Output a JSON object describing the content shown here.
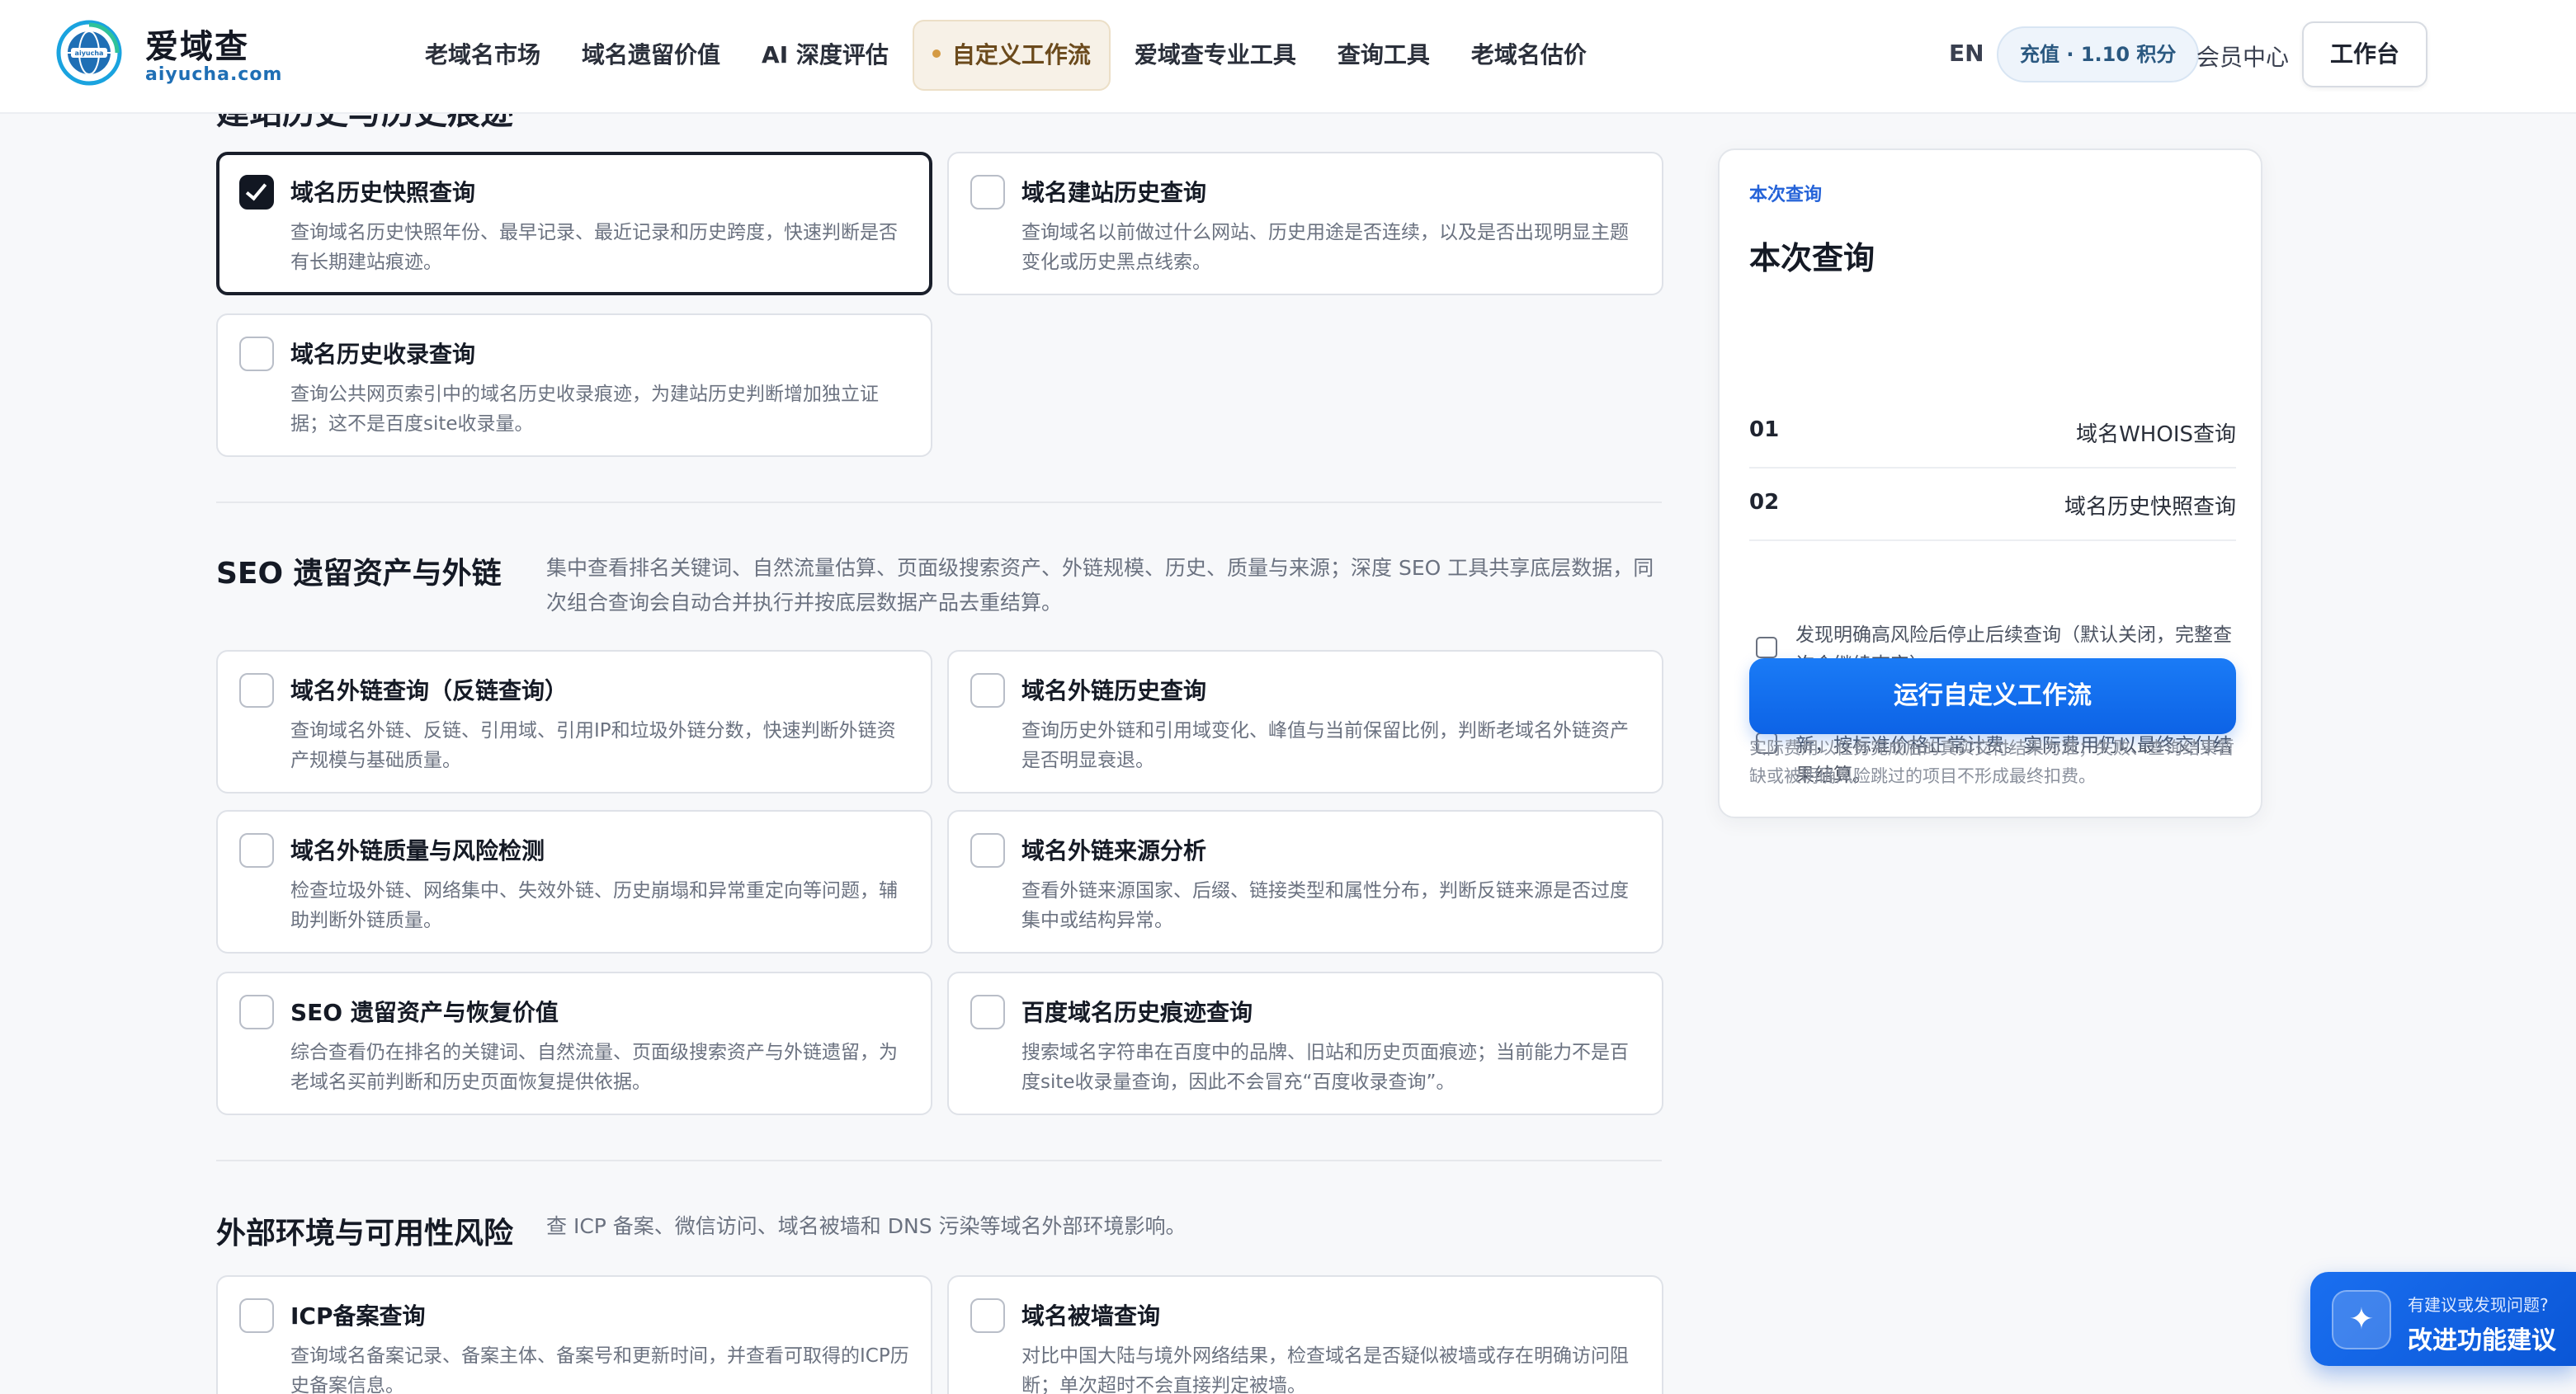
{
  "brand": {
    "name": "爱域查",
    "domain": "aiyucha.com",
    "logo_text": "aiyucha"
  },
  "nav": {
    "items": [
      {
        "label": "老域名市场"
      },
      {
        "label": "域名遗留价值"
      },
      {
        "label": "AI 深度评估"
      },
      {
        "label": "自定义工作流",
        "active": true
      },
      {
        "label": "爱域查专业工具"
      },
      {
        "label": "查询工具"
      },
      {
        "label": "老域名估价"
      }
    ]
  },
  "header_right": {
    "lang": "EN",
    "recharge": "充值 · 1.10 积分",
    "member": "会员中心",
    "workbench": "工作台"
  },
  "sections": [
    {
      "title": "建站历史与历史痕迹",
      "cards": [
        {
          "title": "域名历史快照查询",
          "desc": "查询域名历史快照年份、最早记录、最近记录和历史跨度，快速判断是否有长期建站痕迹。",
          "checked": true
        },
        {
          "title": "域名建站历史查询",
          "desc": "查询域名以前做过什么网站、历史用途是否连续，以及是否出现明显主题变化或历史黑点线索。",
          "checked": false
        },
        {
          "title": "域名历史收录查询",
          "desc": "查询公共网页索引中的域名历史收录痕迹，为建站历史判断增加独立证据；这不是百度site收录量。",
          "checked": false
        }
      ]
    },
    {
      "title": "SEO 遗留资产与外链",
      "desc": "集中查看排名关键词、自然流量估算、页面级搜索资产、外链规模、历史、质量与来源；深度 SEO 工具共享底层数据，同次组合查询会自动合并执行并按底层数据产品去重结算。",
      "cards": [
        {
          "title": "域名外链查询（反链查询）",
          "desc": "查询域名外链、反链、引用域、引用IP和垃圾外链分数，快速判断外链资产规模与基础质量。",
          "checked": false
        },
        {
          "title": "域名外链历史查询",
          "desc": "查询历史外链和引用域变化、峰值与当前保留比例，判断老域名外链资产是否明显衰退。",
          "checked": false
        },
        {
          "title": "域名外链质量与风险检测",
          "desc": "检查垃圾外链、网络集中、失效外链、历史崩塌和异常重定向等问题，辅助判断外链质量。",
          "checked": false
        },
        {
          "title": "域名外链来源分析",
          "desc": "查看外链来源国家、后缀、链接类型和属性分布，判断反链来源是否过度集中或结构异常。",
          "checked": false
        },
        {
          "title": "SEO 遗留资产与恢复价值",
          "desc": "综合查看仍在排名的关键词、自然流量、页面级搜索资产与外链遗留，为老域名买前判断和历史页面恢复提供依据。",
          "checked": false
        },
        {
          "title": "百度域名历史痕迹查询",
          "desc": "搜索域名字符串在百度中的品牌、旧站和历史页面痕迹；当前能力不是百度site收录量查询，因此不会冒充“百度收录查询”。",
          "checked": false
        }
      ]
    },
    {
      "title": "外部环境与可用性风险",
      "desc": "查 ICP 备案、微信访问、域名被墙和 DNS 污染等域名外部环境影响。",
      "cards": [
        {
          "title": "ICP备案查询",
          "desc": "查询域名备案记录、备案主体、备案号和更新时间，并查看可取得的ICP历史备案信息。",
          "checked": false
        },
        {
          "title": "域名被墙查询",
          "desc": "对比中国大陆与境外网络结果，检查域名是否疑似被墙或存在明确访问阻断；单次超时不会直接判定被墙。",
          "checked": false
        }
      ]
    }
  ],
  "panel": {
    "eyebrow": "本次查询",
    "title": "本次查询",
    "rows": [
      {
        "idx": "01",
        "name": "域名WHOIS查询"
      },
      {
        "idx": "02",
        "name": "域名历史快照查询"
      }
    ],
    "options": [
      {
        "text": "发现明确高风险后停止后续查询（默认关闭，完整查询会继续查完）",
        "checked": false
      },
      {
        "text": "默认优先使用有效缓存；勾选后忽略缓存并强制刷新，按标准价格正常计费。实际费用仍以最终交付结果结算。",
        "checked": false
      }
    ],
    "run_label": "运行自定义工作流",
    "fine_print": "实际费用以任务完成后的真实交付结果为准；失败、查询结果暂缺或被明确风险跳过的项目不形成最终扣费。"
  },
  "feedback": {
    "small": "有建议或发现问题?",
    "big": "改进功能建议"
  },
  "colors": {
    "accent": "#0d63e6",
    "nav_active_bg": "#f7f1e7",
    "selected_border": "#1a1f2b"
  }
}
